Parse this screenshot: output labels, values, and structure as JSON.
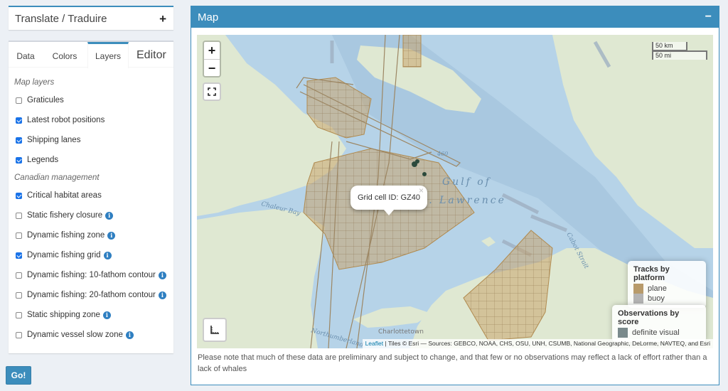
{
  "translate": {
    "title": "Translate / Traduire",
    "toggle": "+"
  },
  "tabs": [
    {
      "label": "Data"
    },
    {
      "label": "Colors"
    },
    {
      "label": "Layers"
    },
    {
      "label": "Editor"
    }
  ],
  "layers": {
    "map_group_title": "Map layers",
    "map_items": [
      {
        "label": "Graticules",
        "checked": false
      },
      {
        "label": "Latest robot positions",
        "checked": true
      },
      {
        "label": "Shipping lanes",
        "checked": true
      },
      {
        "label": "Legends",
        "checked": true
      }
    ],
    "canadian_group_title": "Canadian management",
    "canadian_items": [
      {
        "label": "Critical habitat areas",
        "checked": true,
        "info": false
      },
      {
        "label": "Static fishery closure",
        "checked": false,
        "info": true
      },
      {
        "label": "Dynamic fishing zone",
        "checked": false,
        "info": true
      },
      {
        "label": "Dynamic fishing grid",
        "checked": true,
        "info": true
      },
      {
        "label": "Dynamic fishing: 10-fathom contour",
        "checked": false,
        "info": true
      },
      {
        "label": "Dynamic fishing: 20-fathom contour",
        "checked": false,
        "info": true
      },
      {
        "label": "Static shipping zone",
        "checked": false,
        "info": true
      },
      {
        "label": "Dynamic vessel slow zone",
        "checked": false,
        "info": true
      }
    ],
    "info_glyph": "i"
  },
  "go_button": "Go!",
  "map": {
    "title": "Map",
    "collapse": "−",
    "zoom_in": "+",
    "zoom_out": "−",
    "scale_km": "50 km",
    "scale_mi": "50 mi",
    "place_labels": {
      "gulf": "Gulf of",
      "lawrence": "St. Lawrence",
      "chaleur": "Chaleur Bay",
      "cabot": "Cabot Strait",
      "northumberland": "Northumberland",
      "charlottetown": "Charlottetown",
      "depth": "460"
    },
    "popup": {
      "text": "Grid cell ID: GZ40",
      "close": "×"
    },
    "legend_tracks": {
      "title": "Tracks by platform",
      "items": [
        {
          "label": "plane",
          "color": "#b89b6b"
        },
        {
          "label": "buoy",
          "color": "#b4b4b4"
        }
      ]
    },
    "legend_obs": {
      "title": "Observations by score",
      "items": [
        {
          "label": "definite visual",
          "color": "#7a8a8c"
        }
      ]
    },
    "attribution": {
      "leaflet": "Leaflet",
      "rest": " | Tiles © Esri — Sources: GEBCO, NOAA, CHS, OSU, UNH, CSUMB, National Geographic, DeLorme, NAVTEQ, and Esri"
    },
    "colors": {
      "water": "#b6d3e8",
      "land": "#dfe8d2",
      "grid": "#c9a46c",
      "track": "#9c8663",
      "lane": "#9fb0c2"
    }
  },
  "note": "Please note that much of these data are preliminary and subject to change, and that few or no observations may reflect a lack of effort rather than a lack of whales"
}
